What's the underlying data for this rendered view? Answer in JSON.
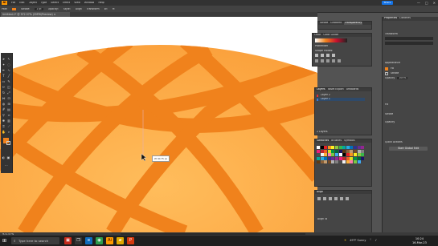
{
  "app": {
    "logo": "Ai",
    "menu": [
      "File",
      "Edit",
      "Object",
      "Type",
      "Select",
      "Effect",
      "View",
      "Window",
      "Help"
    ],
    "share_label": "Share",
    "window_controls": [
      "—",
      "□",
      "✕"
    ]
  },
  "control_bar": {
    "items": [
      "Path",
      "Stroke:",
      "Opacity:",
      "Style:",
      "Align",
      "Transform",
      "W:",
      "H:"
    ],
    "stroke_value": "1 pt"
  },
  "document_tab": {
    "label": "Untitled-1* @ 972.57% (CMYK/Preview)",
    "close": "×"
  },
  "tooltip": {
    "text": "W: 64.75 px"
  },
  "panels": {
    "stroke_tabs": [
      "Stroke",
      "Gradient",
      "Transparency"
    ],
    "color_tabs": [
      "Color",
      "Color Guide"
    ],
    "layers_tabs": [
      "Layers",
      "Asset Export",
      "Artboards"
    ],
    "layers": [
      {
        "name": "Layer 2",
        "color": "#e03030"
      },
      {
        "name": "Layer 1",
        "color": "#3a78d0"
      }
    ],
    "layers_footer": "2 Layers",
    "swatches_tabs": [
      "Swatches",
      "Brushes",
      "Symbols"
    ],
    "pathfinder_label": "Pathfinder",
    "shape_modes_label": "Shape Modes:",
    "align_label": "Align",
    "align_to_label": "Align To"
  },
  "right_panel": {
    "tabs": [
      "Properties",
      "Libraries"
    ],
    "sections": [
      "Transform",
      "Appearance",
      "Fill",
      "Stroke",
      "Opacity",
      "Quick Actions"
    ],
    "fill_label": "Fill",
    "stroke_label": "Stroke",
    "opacity_label": "Opacity",
    "opacity_value": "100%",
    "quick_action": "Start Global Edit"
  },
  "status_bar": {
    "zoom": "972.57%"
  },
  "taskbar": {
    "search_placeholder": "Type here to search",
    "weather": "49°F Sunny",
    "time": "10:24",
    "date": "16-Mar-23"
  },
  "colors": {
    "orange_fill": "#fdb24e",
    "lattice": "#f0821c",
    "ui_dark": "#323232",
    "accent_blue": "#1473e6"
  }
}
